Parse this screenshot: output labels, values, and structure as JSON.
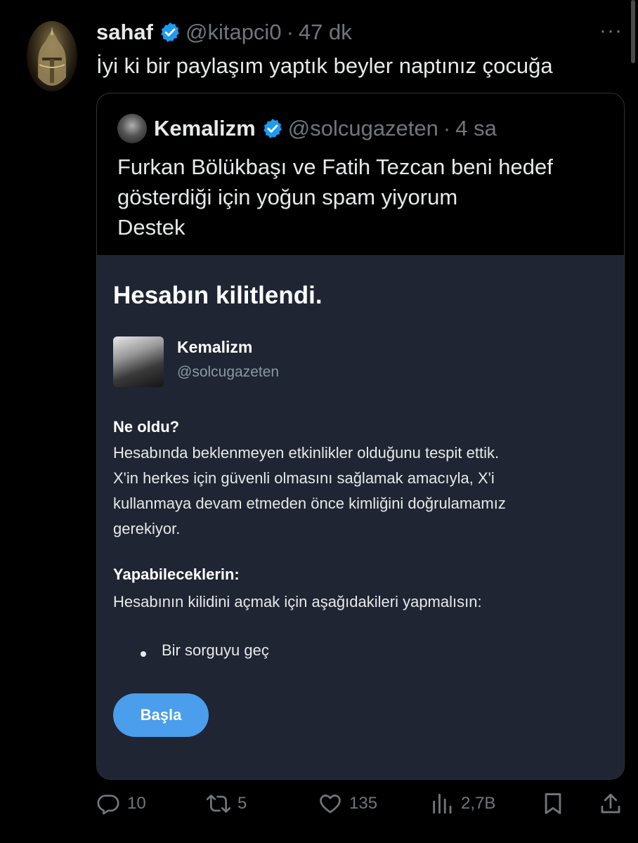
{
  "post": {
    "author_name": "sahaf",
    "author_handle": "@kitapci0",
    "separator": "·",
    "time": "47 dk",
    "more_label": "···",
    "text": "İyi ki bir paylaşım yaptık beyler naptınız çocuğa"
  },
  "quote": {
    "author_name": "Kemalizm",
    "author_handle": "@solcugazeten",
    "separator": "·",
    "time": "4 sa",
    "lines": [
      "Furkan Bölükbaşı ve Fatih Tezcan beni hedef",
      "gösterdiği için yoğun spam yiyorum",
      "Destek"
    ]
  },
  "lock_card": {
    "title": "Hesabın kilitlendi.",
    "name": "Kemalizm",
    "handle": "@solcugazeten",
    "what_happened_heading": "Ne oldu?",
    "what_happened_lines": [
      "Hesabında beklenmeyen etkinlikler olduğunu tespit ettik.",
      "X'in herkes için güvenli olmasını sağlamak amacıyla, X'i",
      "kullanmaya devam etmeden önce kimliğini doğrulamamız",
      "gerekiyor."
    ],
    "todo_heading": "Yapabileceklerin:",
    "todo_text": "Hesabının kilidini açmak için aşağıdakileri yapmalısın:",
    "bullet": "Bir sorguyu geç",
    "button_label": "Başla"
  },
  "actions": {
    "replies": "10",
    "reposts": "5",
    "likes": "135",
    "views": "2,7B"
  },
  "colors": {
    "background": "#000000",
    "text": "#e7e9ea",
    "muted": "#71767b",
    "verified": "#1d9bf0",
    "card_background": "#1f2532",
    "button": "#4a9eeb"
  },
  "icons": {
    "reply": "reply-icon",
    "repost": "repost-icon",
    "like": "heart-icon",
    "views": "views-icon",
    "bookmark": "bookmark-icon",
    "share": "share-icon",
    "verified": "verified-badge-icon",
    "more": "more-icon"
  }
}
